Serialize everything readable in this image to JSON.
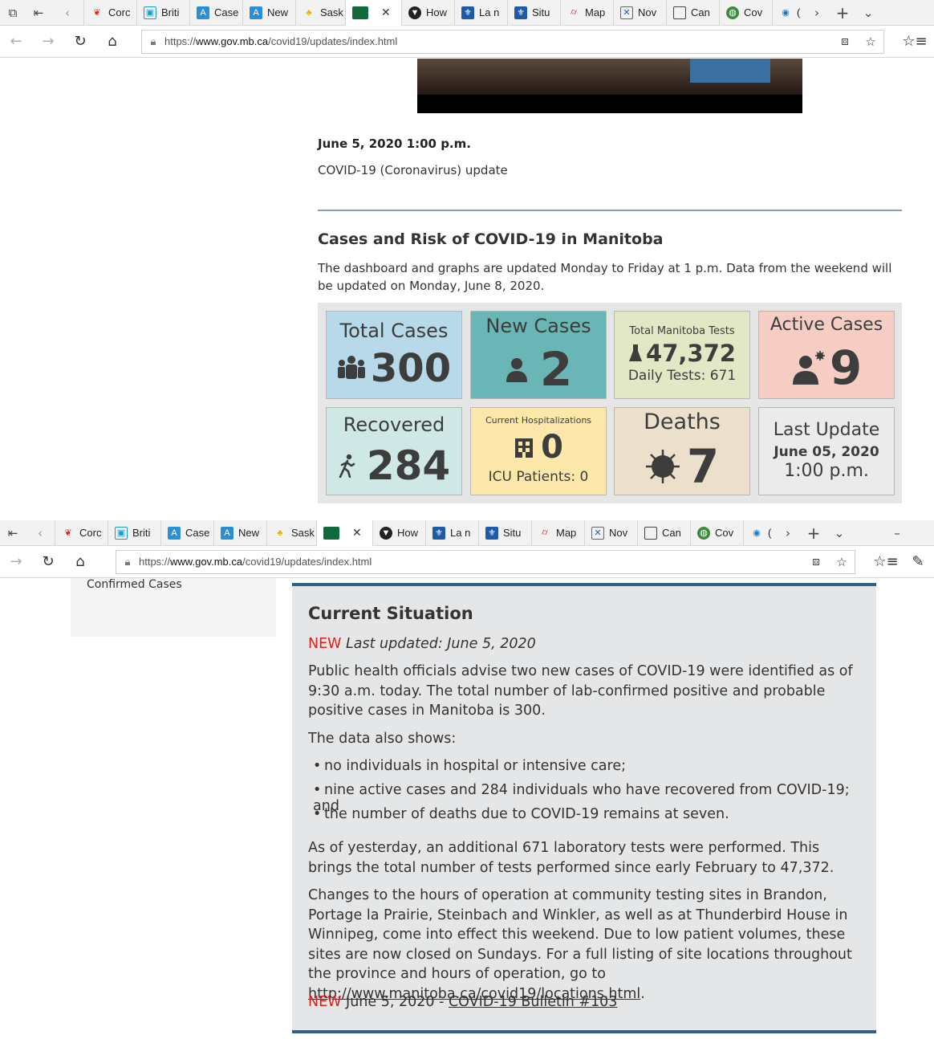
{
  "browser": {
    "tabs": [
      {
        "label": "Corc",
        "icon": "maple-leaf-icon"
      },
      {
        "label": "Briti",
        "icon": "bc-icon"
      },
      {
        "label": "Case",
        "icon": "alberta-icon"
      },
      {
        "label": "New",
        "icon": "alberta-icon"
      },
      {
        "label": "Sask",
        "icon": "sask-icon"
      },
      {
        "label": "",
        "icon": "manitoba-icon",
        "active": true
      },
      {
        "label": "How",
        "icon": "shield-icon"
      },
      {
        "label": "La n",
        "icon": "quebec-icon"
      },
      {
        "label": "Situ",
        "icon": "quebec-icon"
      },
      {
        "label": "Map",
        "icon": "map-icon"
      },
      {
        "label": "Nov",
        "icon": "ns-icon"
      },
      {
        "label": "Can",
        "icon": "page-icon"
      },
      {
        "label": "Cov",
        "icon": "globe-icon"
      },
      {
        "label": "(",
        "icon": "nwt-icon"
      }
    ],
    "url_prefix": "https://",
    "url_domain": "www.gov.mb.ca",
    "url_path": "/covid19/updates/index.html"
  },
  "page1": {
    "date": "June 5, 2020 1:00 p.m.",
    "subtitle": "COVID-19 (Coronavirus) update",
    "heading": "Cases and Risk of COVID-19 in Manitoba",
    "intro": "The dashboard and graphs are updated Monday to Friday at 1 p.m. Data from the weekend will be updated on Monday, June 8, 2020.",
    "dashboard": {
      "total_cases": {
        "label": "Total Cases",
        "value": "300",
        "color": "#b7d9ea"
      },
      "new_cases": {
        "label": "New Cases",
        "value": "2",
        "color": "#6ab5b5"
      },
      "tests": {
        "label": "Total Manitoba Tests",
        "value": "47,372",
        "sub": "Daily Tests: 671",
        "color": "#e2e7c6"
      },
      "active_cases": {
        "label": "Active Cases",
        "value": "9",
        "color": "#f5cdc5"
      },
      "recovered": {
        "label": "Recovered",
        "value": "284",
        "color": "#cfe8e6"
      },
      "hospitalizations": {
        "label": "Current Hospitalizations",
        "value": "0",
        "sub": "ICU Patients: 0",
        "color": "#fde8ab"
      },
      "deaths": {
        "label": "Deaths",
        "value": "7",
        "color": "#ece0cc"
      },
      "last_update": {
        "label": "Last Update",
        "date": "June 05, 2020",
        "time": "1:00 p.m.",
        "color": "#ebebeb"
      }
    }
  },
  "page2": {
    "sidebar_item": "Confirmed Cases",
    "heading": "Current Situation",
    "new_tag": "NEW",
    "last_updated": "Last updated: June 5, 2020",
    "para1": "Public health officials advise two new cases of COVID-19 were identified as of 9:30 a.m. today. The total number of lab-confirmed positive and probable positive cases in Manitoba is 300.",
    "data_shows": "The data also shows:",
    "bullets": [
      "no individuals in hospital or intensive care;",
      "nine active cases and 284 individuals who have recovered from COVID-19; and",
      "the number of deaths due to COVID-19 remains at seven."
    ],
    "para2": "As of yesterday, an additional 671 laboratory tests were performed. This brings the total number of tests performed since early February to 47,372.",
    "para3_text": "Changes to the hours of operation at community testing sites in Brandon, Portage la Prairie, Steinbach and Winkler, as well as at Thunderbird House in Winnipeg, come into effect this weekend. Due to low patient volumes, these sites are now closed on Sundays. For a full listing of site locations throughout the province and hours of operation, go to ",
    "para3_link": "http://www.manitoba.ca/covid19/locations.html",
    "para3_end": ".",
    "bulletin_date": "June 5, 2020 - ",
    "bulletin_link": "COVID-19 Bulletin #103"
  }
}
